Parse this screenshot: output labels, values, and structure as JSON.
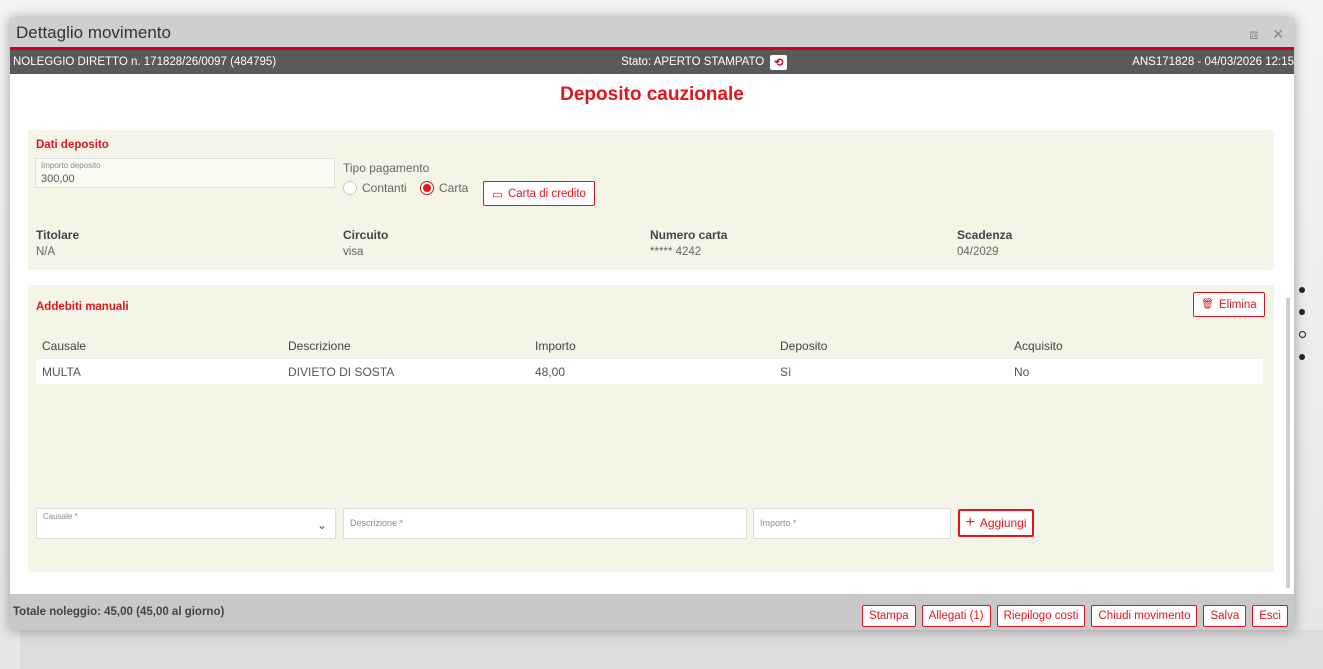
{
  "window": {
    "title": "Dettaglio movimento",
    "restore_icon": "⧈",
    "close_icon": "✕"
  },
  "infobar": {
    "left": "NOLEGGIO DIRETTO n. 171828/26/0097 (484795)",
    "state": "Stato: APERTO STAMPATO",
    "state_icon": "⟲",
    "right": "ANS171828 - 04/03/2026 12:15"
  },
  "main_title": "Deposito cauzionale",
  "deposit": {
    "section_title": "Dati deposito",
    "amount_label": "Importo deposito",
    "amount_value": "300,00",
    "payment_type_label": "Tipo pagamento",
    "option_cash": "Contanti",
    "option_card": "Carta",
    "selected": "Carta",
    "card_button": "Carta di credito",
    "card_icon": "▭",
    "holder_label": "Titolare",
    "holder_value": "N/A",
    "circuit_label": "Circuito",
    "circuit_value": "visa",
    "card_number_label": "Numero carta",
    "card_number_value": "***** 4242",
    "expiry_label": "Scadenza",
    "expiry_value": "04/2029"
  },
  "charges": {
    "section_title": "Addebiti manuali",
    "delete_button": "Elimina",
    "delete_icon": "🗑",
    "columns": [
      "Causale",
      "Descrizione",
      "Importo",
      "Deposito",
      "Acquisito"
    ],
    "rows": [
      [
        "MULTA",
        "DIVIETO DI SOSTA",
        "48,00",
        "Sì",
        "No"
      ]
    ],
    "causale_placeholder": "Causale *",
    "descrizione_placeholder": "Descrizione *",
    "importo_placeholder": "Importo *",
    "add_button": "Aggiungi",
    "add_icon": "+",
    "chevron_icon": "⌄"
  },
  "footer": {
    "total": "Totale noleggio: 45,00 (45,00 al giorno)",
    "buttons": [
      "Stampa",
      "Allegati (1)",
      "Riepilogo costi",
      "Chiudi movimento",
      "Salva",
      "Esci"
    ]
  },
  "colors": {
    "accent": "#e3141e",
    "panel_bg": "#f4f5e7",
    "infobar_bg": "#5a5a5a"
  }
}
